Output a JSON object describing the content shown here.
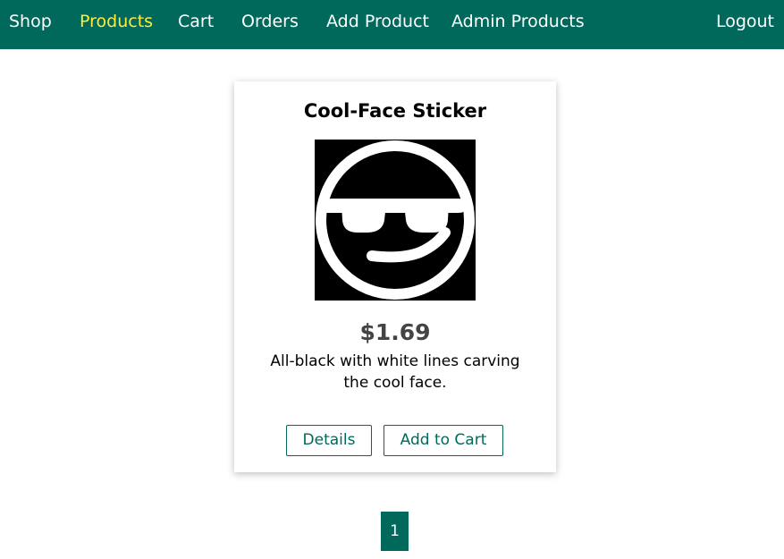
{
  "nav": {
    "shop": "Shop",
    "products": "Products",
    "cart": "Cart",
    "orders": "Orders",
    "add_product": "Add Product",
    "admin_products": "Admin Products",
    "logout": "Logout",
    "active_item": "products"
  },
  "product": {
    "title": "Cool-Face Sticker",
    "image_icon": "sunglasses-smiley-icon",
    "price": "$1.69",
    "description": "All-black with white lines carving the cool face.",
    "details_label": "Details",
    "add_to_cart_label": "Add to Cart"
  },
  "pagination": {
    "current_page": "1"
  },
  "colors": {
    "brand": "#00695c",
    "active_nav": "#ffeb3b",
    "price_text": "#444444"
  }
}
